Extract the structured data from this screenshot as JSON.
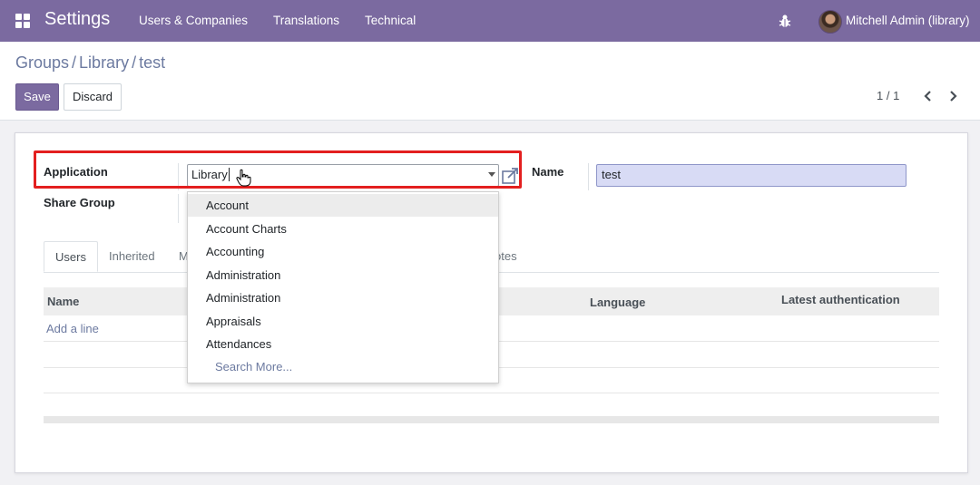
{
  "navbar": {
    "app_name": "Settings",
    "menu": [
      "Users & Companies",
      "Translations",
      "Technical"
    ],
    "user": "Mitchell Admin (library)",
    "icons": [
      "apps-grid-icon",
      "bug-icon",
      "avatar"
    ]
  },
  "breadcrumb": [
    "Groups",
    "Library",
    "test"
  ],
  "buttons": {
    "save": "Save",
    "discard": "Discard"
  },
  "pager": {
    "text": "1 / 1"
  },
  "form": {
    "application_label": "Application",
    "application_value": "Library",
    "share_group_label": "Share Group",
    "name_label": "Name",
    "name_value": "test"
  },
  "tabs": {
    "users": "Users",
    "inherited": "Inherited",
    "m": "M",
    "notes": "otes"
  },
  "table": {
    "headers": {
      "name": "Name",
      "language": "Language",
      "latest_auth": "Latest authentication"
    },
    "add_line": "Add a line"
  },
  "dropdown": {
    "items": [
      "Account",
      "Account Charts",
      "Accounting",
      "Administration",
      "Administration",
      "Appraisals",
      "Attendances"
    ],
    "search_more": "Search More..."
  },
  "colors": {
    "navbar": "#7b6aa0",
    "highlight": "#e31f1f",
    "name_field_bg": "#d8dbf5"
  }
}
